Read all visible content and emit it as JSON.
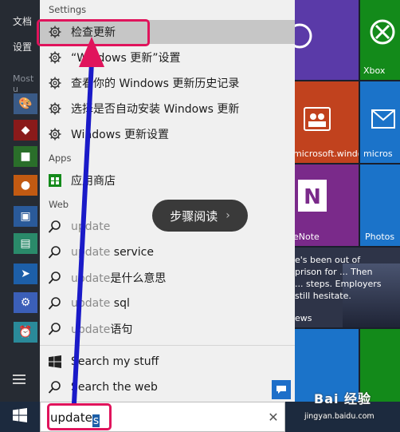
{
  "start_menu": {
    "docs_label": "文档",
    "settings_label": "设置",
    "most_used_label": "Most u",
    "all_apps_icon": "list-icon"
  },
  "tiles": {
    "xbox": "Xbox",
    "microsoft_windows": "microsoft.windo",
    "microsoft_right": "micros",
    "onenote": "eNote",
    "photos": "Photos",
    "news_text": "e's been out of prison for ... Then ... steps. Employers still hesitate.",
    "news_footer": "ews"
  },
  "search_panel": {
    "groups": {
      "settings": "Settings",
      "apps": "Apps",
      "web": "Web"
    },
    "settings_results": [
      {
        "label": "检查更新",
        "icon": "gear-icon"
      },
      {
        "label": "“Windows 更新”设置",
        "icon": "gear-icon"
      },
      {
        "label": "查看你的 Windows 更新历史记录",
        "icon": "gear-icon"
      },
      {
        "label": "选择是否自动安装 Windows 更新",
        "icon": "gear-icon"
      },
      {
        "label": "Windows 更新设置",
        "icon": "gear-icon"
      }
    ],
    "app_results": [
      {
        "label": "应用商店",
        "icon": "store-icon"
      }
    ],
    "web_results": [
      {
        "query": "update",
        "suffix": ""
      },
      {
        "query": "update",
        "suffix": " service"
      },
      {
        "query": "update",
        "suffix": "是什么意思"
      },
      {
        "query": "update",
        "suffix": " sql"
      },
      {
        "query": "update",
        "suffix": "语句"
      }
    ],
    "search_my_stuff": "Search my stuff",
    "search_the_web": "Search the web",
    "steps_pill": "步骤阅读",
    "steps_chevron": "›"
  },
  "taskbar": {
    "search_value": "update",
    "search_caret_char": "s",
    "clear_glyph": "✕"
  },
  "watermark": {
    "title": "Bai 经验",
    "url": "jingyan.baidu.com"
  },
  "colors": {
    "highlight": "#e0145c",
    "arrow": "#1a1ac8",
    "arrow_head": "#e0145c",
    "accent": "#1e6fc9"
  }
}
